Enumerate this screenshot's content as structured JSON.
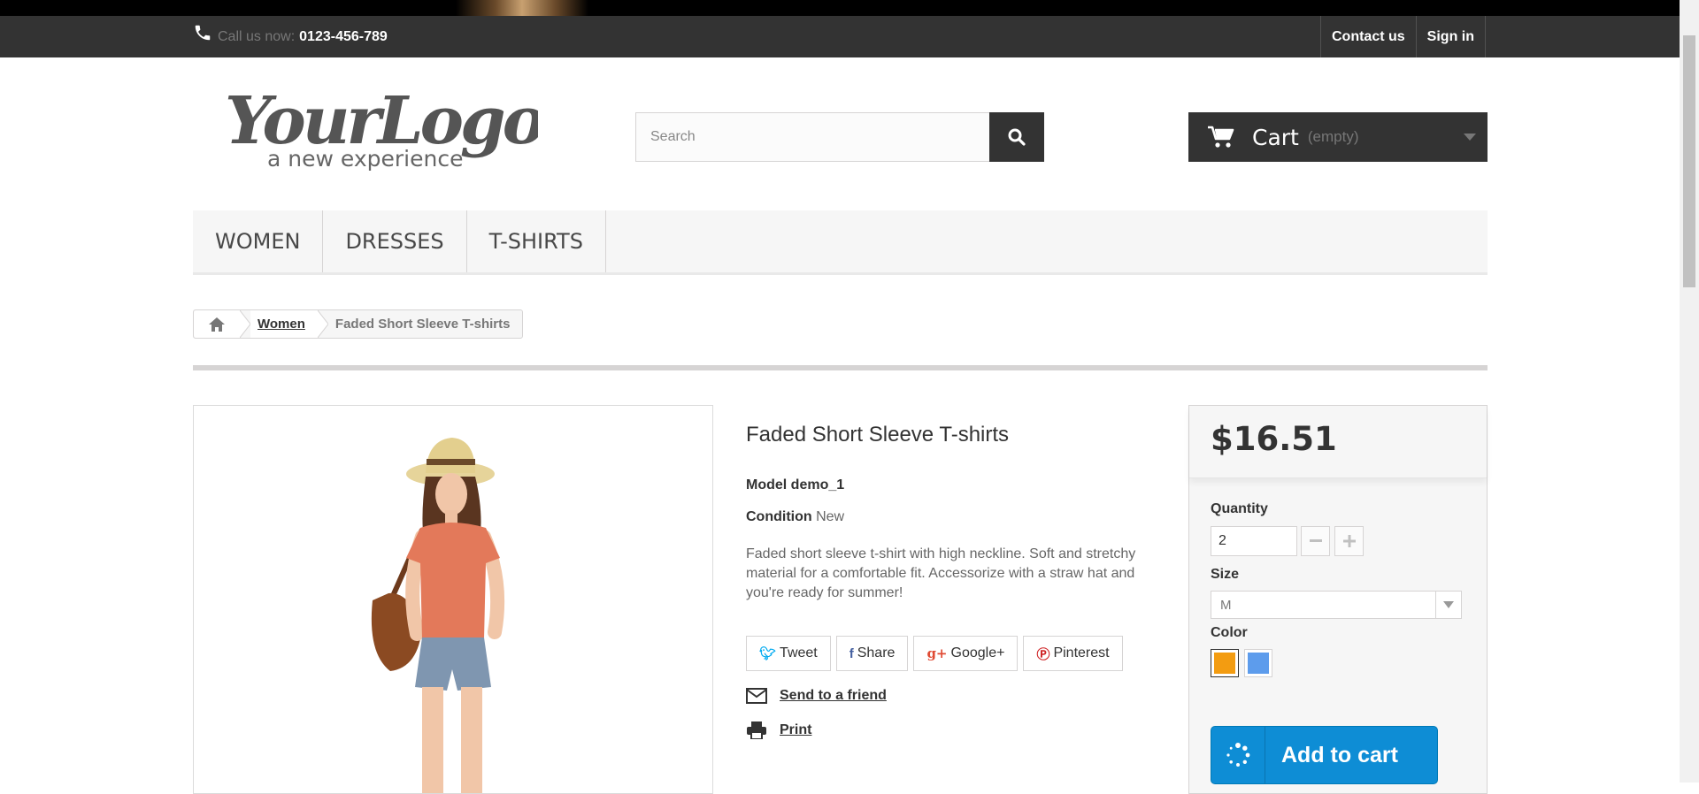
{
  "header": {
    "call_label": "Call us now:",
    "phone": "0123-456-789",
    "nav": [
      {
        "label": "Contact us"
      },
      {
        "label": "Sign in"
      }
    ]
  },
  "logo": {
    "text": "YourLogo",
    "tagline": "a new experience"
  },
  "search": {
    "placeholder": "Search",
    "value": ""
  },
  "cart": {
    "label": "Cart",
    "status": "(empty)"
  },
  "menu": {
    "items": [
      {
        "label": "Women"
      },
      {
        "label": "Dresses"
      },
      {
        "label": "T-shirts"
      }
    ]
  },
  "breadcrumb": {
    "items": [
      "Women",
      "Faded Short Sleeve T-shirts"
    ]
  },
  "product": {
    "title": "Faded Short Sleeve T-shirts",
    "model_label": "Model",
    "model": "demo_1",
    "condition_label": "Condition",
    "condition": "New",
    "description": "Faded short sleeve t-shirt with high neckline. Soft and stretchy material for a comfortable fit. Accessorize with a straw hat and you're ready for summer!"
  },
  "social": [
    {
      "label": "Tweet",
      "icon": "twitter-icon",
      "color": "#00aaf0"
    },
    {
      "label": "Share",
      "icon": "facebook-icon",
      "color": "#435f9f"
    },
    {
      "label": "Google+",
      "icon": "google-plus-icon",
      "color": "#e04b34"
    },
    {
      "label": "Pinterest",
      "icon": "pinterest-icon",
      "color": "#ce1f21"
    }
  ],
  "actions": {
    "send_to_friend": "Send to a friend",
    "print": "Print"
  },
  "buybox": {
    "price": "$16.51",
    "quantity_label": "Quantity",
    "quantity_value": "2",
    "size_label": "Size",
    "size_value": "M",
    "color_label": "Color",
    "colors": [
      {
        "name": "Orange",
        "hex": "#f39c11",
        "selected": true
      },
      {
        "name": "Blue",
        "hex": "#5d9cec",
        "selected": false
      }
    ],
    "add_to_cart_label": "Add to cart"
  },
  "colors": {
    "topbar": "#333333",
    "accent_blue": "#0e8dd5"
  }
}
